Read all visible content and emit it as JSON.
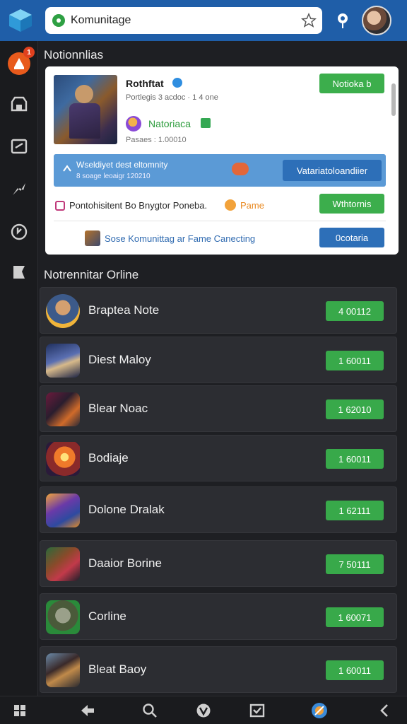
{
  "topbar": {
    "url": "Komunitage",
    "icons": [
      "app-cube-icon",
      "secure-icon",
      "star-icon",
      "location-pin-icon",
      "user-avatar"
    ]
  },
  "sidebar": {
    "badge": "1",
    "items": [
      "notifications-icon",
      "store-icon",
      "library-icon",
      "activity-icon",
      "history-icon",
      "bookmark-icon"
    ]
  },
  "notifications": {
    "title": "Notionnlias",
    "card": {
      "name": "Rothftat",
      "meta": "Portlegis 3 acdoc · 1 4 one",
      "follow_label": "Notioka b",
      "sub_name": "Natoriaca",
      "price": "Pasaes : 1.00010",
      "alert_line1": "Wseldiyet dest eltomnity",
      "alert_line2": "8 soage leoaigr 120210",
      "alert_button": "Vatariatoloandiier",
      "row3_text": "Pontohisitent Bo Bnygtor Poneba.",
      "row3_label": "Pame",
      "row3_button": "Wthtornis",
      "row4_text": "Sose Komunittag ar Fame Canecting",
      "row4_button": "0cotaria"
    }
  },
  "online": {
    "title": "Notrennitar Orline",
    "items": [
      {
        "name": "Braptea Note",
        "button": "4 00112"
      },
      {
        "name": "Diest Maloy",
        "button": "1 60011"
      },
      {
        "name": "Blear Noac",
        "button": "1 62010"
      },
      {
        "name": "Bodiaje",
        "button": "1 60011"
      },
      {
        "name": "Dolone Dralak",
        "button": "1 62111"
      },
      {
        "name": "Daaior Borine",
        "button": "7 50111"
      },
      {
        "name": "Corline",
        "button": "1 60071"
      },
      {
        "name": "Bleat Baoy",
        "button": "1 60011"
      }
    ]
  },
  "bottombar": {
    "icons": [
      "grid-icon",
      "back-arrow-icon",
      "search-icon",
      "vote-icon",
      "inbox-icon",
      "game-controller-icon",
      "chevron-left-icon"
    ]
  },
  "colors": {
    "topbar": "#1f5ea8",
    "accent_green": "#38a94a",
    "accent_blue": "#2d6fb8",
    "background": "#1e1f23"
  }
}
